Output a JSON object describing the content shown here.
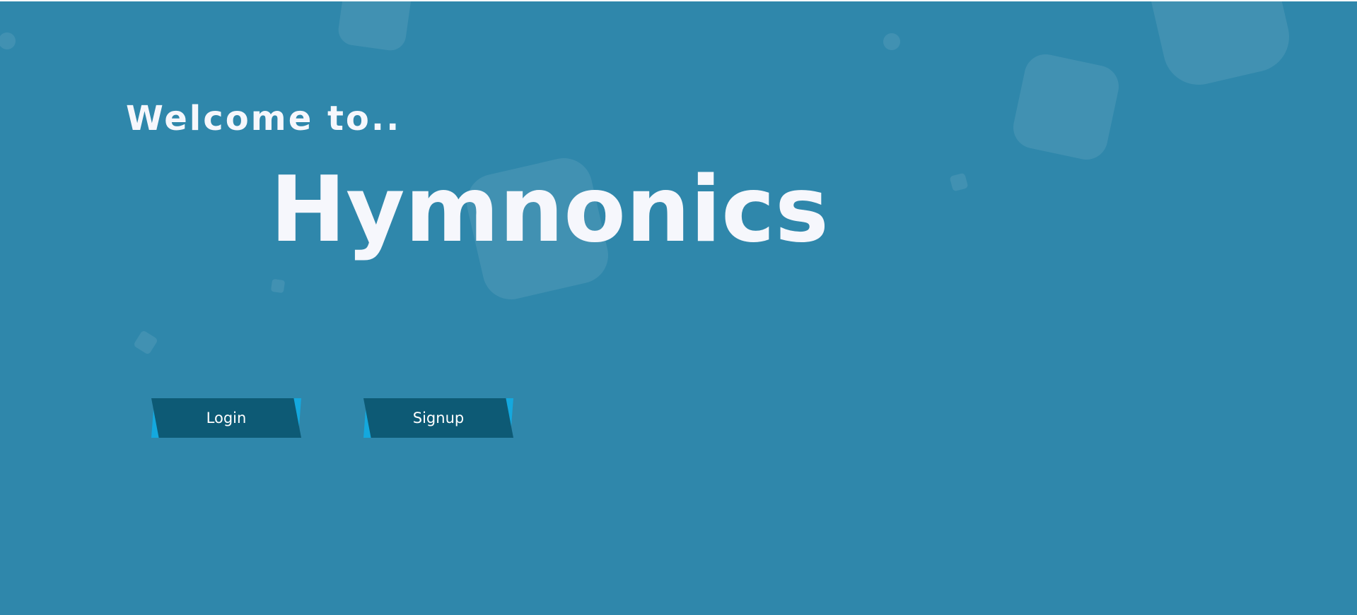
{
  "hero": {
    "welcome_text": "Welcome to..",
    "brand_name": "Hymnonics"
  },
  "actions": {
    "login_label": "Login",
    "signup_label": "Signup"
  },
  "colors": {
    "background": "#2f87ab",
    "text": "#f6f7fc",
    "button": "#0d5a75",
    "button_accent": "#14a8de"
  }
}
